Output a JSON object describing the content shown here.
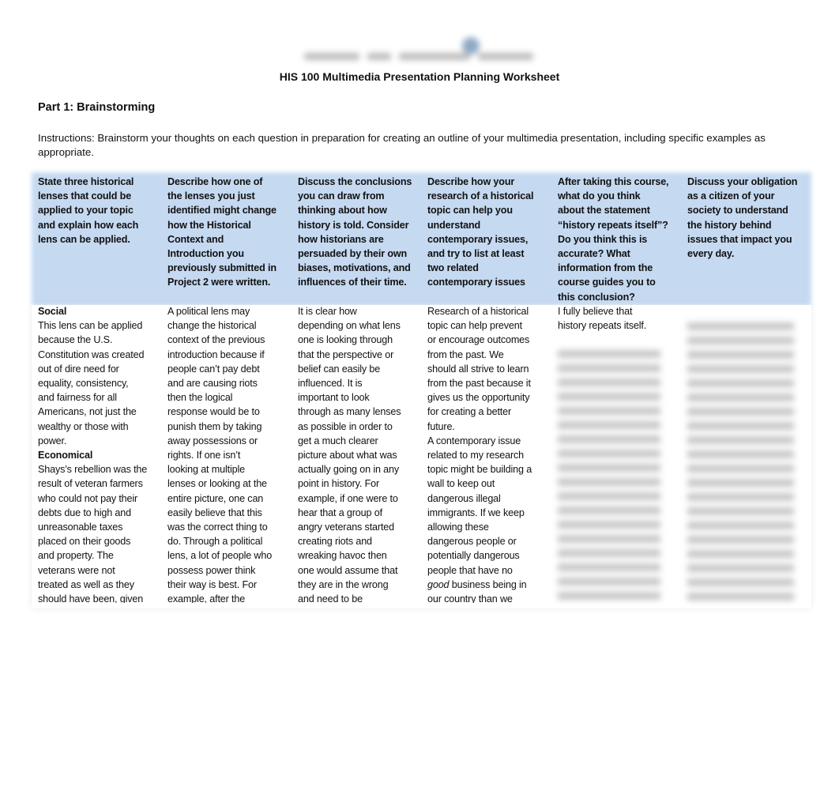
{
  "logo_text": "Southern New Hampshire University",
  "title": "HIS 100 Multimedia Presentation Planning Worksheet",
  "part": "Part 1: Brainstorming",
  "instructions": "Instructions: Brainstorm your thoughts on each question in preparation for creating an outline of your multimedia presentation, including specific examples as appropriate.",
  "headers": [
    "State three historical\nlenses that could be\napplied to your topic\nand explain how each\nlens can be applied.",
    "Describe how one of\nthe lenses you just\nidentified might change\nhow the Historical\nContext and\nIntroduction you\npreviously submitted in\nProject 2 were written.",
    "Discuss the conclusions\nyou can draw from\nthinking about how\nhistory is told. Consider\nhow historians are\npersuaded by their own\nbiases, motivations, and\ninfluences of their time.",
    "Describe how your\nresearch of a historical\ntopic can help you\nunderstand\ncontemporary issues,\nand try to list at least\ntwo related\ncontemporary issues",
    "After taking this course,\nwhat do you think\nabout the statement\n“history repeats itself”?\nDo you think this is\naccurate? What\ninformation from the\ncourse guides you to\nthis conclusion?",
    "Discuss your obligation\nas a citizen of your\nsociety to understand\nthe history behind\nissues that impact you\nevery day."
  ],
  "col1": {
    "h1": "Social",
    "t1": "This lens can be applied\nbecause the U.S.\nConstitution was created\nout of dire need for\nequality, consistency,\nand fairness for all\nAmericans, not just the\nwealthy or those with\npower.",
    "h2": "Economical",
    "t2": "Shays’s rebellion was the\nresult of veteran farmers\nwho could not pay their\ndebts due to high and\nunreasonable taxes\nplaced on their goods\nand property. The\nveterans were not\ntreated as well as they\nshould have been, given"
  },
  "col2": "A political lens may\nchange the historical\ncontext of the previous\nintroduction because if\npeople can’t pay debt\nand are causing riots\nthen the logical\nresponse would be to\npunish them by taking\naway possessions or\nrights. If one isn’t\nlooking at multiple\nlenses or looking at the\nentire picture, one can\neasily believe that this\nwas the correct thing to\ndo. Through a political\nlens, a lot of people who\npossess power think\ntheir way is best. For\nexample, after the",
  "col3": "It is clear how\ndepending on what lens\none is looking through\nthat the perspective or\nbelief can easily be\ninfluenced. It is\nimportant to look\nthrough as many lenses\nas possible in order to\nget a much clearer\npicture about what was\nactually going on in any\npoint in history. For\nexample, if one were to\nhear that a group of\nangry veterans started\ncreating riots and\nwreaking havoc then\none would assume that\nthey are in the wrong\nand need to be",
  "col4": {
    "t1": "Research of a historical\ntopic can help prevent\nor encourage outcomes\nfrom the past. We\nshould all strive to learn\nfrom the past because it\ngives us the opportunity\nfor creating a better\nfuture.\nA contemporary issue\nrelated to my research\ntopic might be building a\nwall to keep out\ndangerous illegal\nimmigrants. If we keep\nallowing these\ndangerous people or\npotentially dangerous\npeople that have no\n",
    "em": "good",
    "t2": " business being in\nour country than we"
  },
  "col5": "I fully believe that\nhistory repeats itself."
}
